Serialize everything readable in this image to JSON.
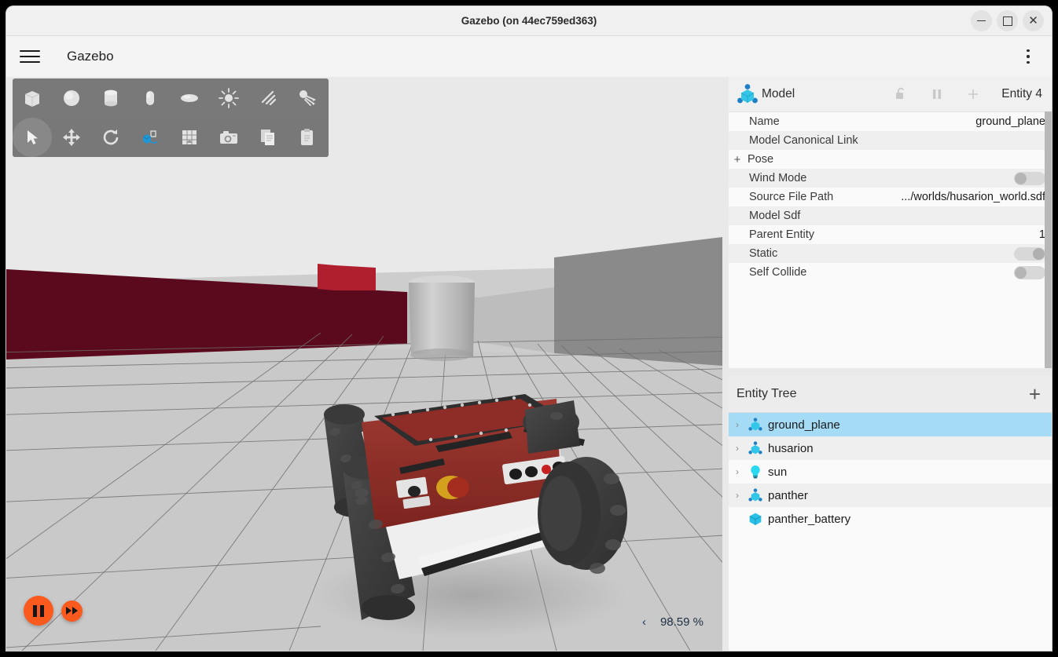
{
  "window": {
    "title": "Gazebo (on 44ec759ed363)",
    "minimize_label": "Minimize",
    "maximize_label": "Maximize",
    "close_label": "Close"
  },
  "menubar": {
    "app_name": "Gazebo",
    "menu_icon": "hamburger-icon",
    "overflow_icon": "kebab-menu-icon"
  },
  "toolbar": {
    "row1": [
      {
        "name": "box-tool",
        "label": "Box"
      },
      {
        "name": "sphere-tool",
        "label": "Sphere"
      },
      {
        "name": "cylinder-tool",
        "label": "Cylinder"
      },
      {
        "name": "capsule-tool",
        "label": "Capsule"
      },
      {
        "name": "ellipsoid-tool",
        "label": "Ellipsoid"
      },
      {
        "name": "point-light-tool",
        "label": "Point Light"
      },
      {
        "name": "directional-light-tool",
        "label": "Directional Light"
      },
      {
        "name": "spot-light-tool",
        "label": "Spot Light"
      }
    ],
    "row2": [
      {
        "name": "select-tool",
        "label": "Select",
        "selected": true
      },
      {
        "name": "translate-tool",
        "label": "Translate"
      },
      {
        "name": "rotate-tool",
        "label": "Rotate"
      },
      {
        "name": "transform-tool",
        "label": "Transform Control"
      },
      {
        "name": "snap-grid-tool",
        "label": "Snap to Grid"
      },
      {
        "name": "screenshot-tool",
        "label": "Screenshot"
      },
      {
        "name": "copy-tool",
        "label": "Copy"
      },
      {
        "name": "paste-tool",
        "label": "Paste"
      }
    ]
  },
  "viewport": {
    "sim_controls": {
      "pause_label": "Pause",
      "step_label": "Step"
    },
    "rtf": {
      "collapse_label": "‹",
      "value": "98.59 %"
    },
    "scene": {
      "models": [
        "husarion panther robot",
        "grey cylinder",
        "ground plane grid"
      ],
      "wall_dark_red": "#5b0a1e",
      "wall_bright_red": "#b01f2e",
      "wall_mid_grey": "#8a8a8a",
      "wall_light_grey": "#bdbdbd",
      "floor": "#c9c9c9",
      "sky": "#e9e9e9",
      "robot_body": "#8e2c27",
      "robot_tire": "#3c3c3c"
    }
  },
  "properties": {
    "header": {
      "icon": "model-icon",
      "title": "Model",
      "lock_icon": "unlock-icon",
      "pause_icon": "pause-icon",
      "add_icon": "plus-icon",
      "entity_label": "Entity 4"
    },
    "rows": [
      {
        "key": "Name",
        "value": "ground_plane",
        "type": "text",
        "expandable": false
      },
      {
        "key": "Model Canonical Link",
        "value": "",
        "type": "text",
        "expandable": false
      },
      {
        "key": "Pose",
        "value": "",
        "type": "text",
        "expandable": true
      },
      {
        "key": "Wind Mode",
        "value": "off",
        "type": "toggle",
        "expandable": false
      },
      {
        "key": "Source File Path",
        "value": ".../worlds/husarion_world.sdf",
        "type": "text",
        "expandable": false
      },
      {
        "key": "Model Sdf",
        "value": "",
        "type": "text",
        "expandable": false
      },
      {
        "key": "Parent Entity",
        "value": "1",
        "type": "text",
        "expandable": false
      },
      {
        "key": "Static",
        "value": "on",
        "type": "toggle",
        "expandable": false
      },
      {
        "key": "Self Collide",
        "value": "off",
        "type": "toggle",
        "expandable": false
      }
    ]
  },
  "entity_tree": {
    "title": "Entity Tree",
    "add_label": "+",
    "items": [
      {
        "label": "ground_plane",
        "icon": "model-icon",
        "expandable": true,
        "selected": true
      },
      {
        "label": "husarion",
        "icon": "model-icon",
        "expandable": true,
        "selected": false
      },
      {
        "label": "sun",
        "icon": "light-icon",
        "expandable": true,
        "selected": false
      },
      {
        "label": "panther",
        "icon": "model-icon",
        "expandable": true,
        "selected": false
      },
      {
        "label": "panther_battery",
        "icon": "cube-icon",
        "expandable": false,
        "selected": false
      }
    ]
  },
  "colors": {
    "accent_orange": "#fa5a1e",
    "selection_blue": "#a5dbf4",
    "icon_cyan": "#33c6e8",
    "icon_blue": "#1d7fc4"
  }
}
